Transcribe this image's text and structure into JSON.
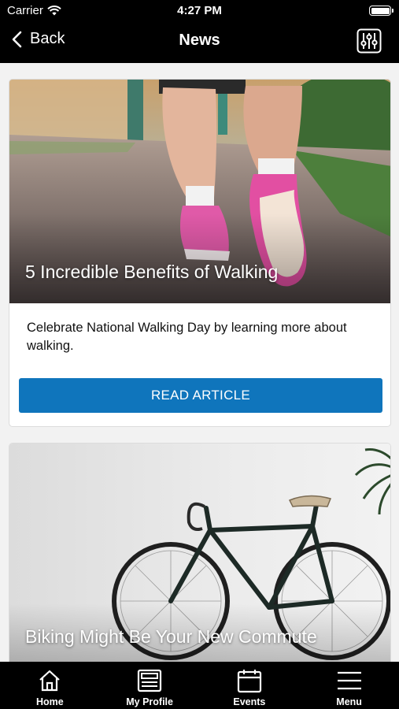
{
  "status_bar": {
    "carrier": "Carrier",
    "time": "4:27 PM"
  },
  "nav": {
    "back_label": "Back",
    "title": "News"
  },
  "articles": [
    {
      "headline": "5 Incredible Benefits of Walking",
      "summary": "Celebrate National Walking Day by learning more about walking.",
      "button_label": "READ ARTICLE"
    },
    {
      "headline": "Biking Might Be Your New Commute"
    }
  ],
  "tabs": [
    {
      "label": "Home",
      "icon": "home-icon"
    },
    {
      "label": "My Profile",
      "icon": "profile-icon"
    },
    {
      "label": "Events",
      "icon": "calendar-icon"
    },
    {
      "label": "Menu",
      "icon": "menu-icon"
    }
  ],
  "colors": {
    "accent": "#0f75bc",
    "bar_background": "#000000"
  }
}
